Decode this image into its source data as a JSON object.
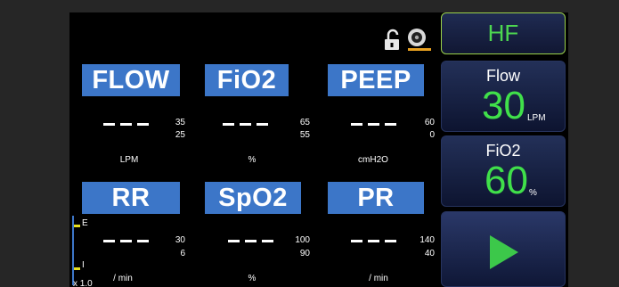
{
  "status": {
    "lock_icon": "unlock-icon",
    "alarm_icon": "speaker-icon"
  },
  "params_top": [
    {
      "label": "FLOW",
      "limit_high": "35",
      "limit_low": "25",
      "unit": "LPM"
    },
    {
      "label": "FiO2",
      "limit_high": "65",
      "limit_low": "55",
      "unit": "%"
    },
    {
      "label": "PEEP",
      "limit_high": "60",
      "limit_low": "0",
      "unit": "cmH2O"
    }
  ],
  "params_bottom": [
    {
      "label": "RR",
      "limit_high": "30",
      "limit_low": "6",
      "unit": "/ min"
    },
    {
      "label": "SpO2",
      "limit_high": "100",
      "limit_low": "90",
      "unit": "%"
    },
    {
      "label": "PR",
      "limit_high": "140",
      "limit_low": "40",
      "unit": "/ min"
    }
  ],
  "ei_indicator": {
    "top_label": "E",
    "bottom_label": "I",
    "ratio": "1.0"
  },
  "right_panel": {
    "mode": "HF",
    "flow": {
      "label": "Flow",
      "value": "30",
      "unit": "LPM"
    },
    "fio2": {
      "label": "FiO2",
      "value": "60",
      "unit": "%"
    },
    "start_icon": "play-icon"
  },
  "colors": {
    "label_blue": "#3c76c8",
    "value_green": "#40e04a",
    "mode_green": "#4dd650"
  }
}
